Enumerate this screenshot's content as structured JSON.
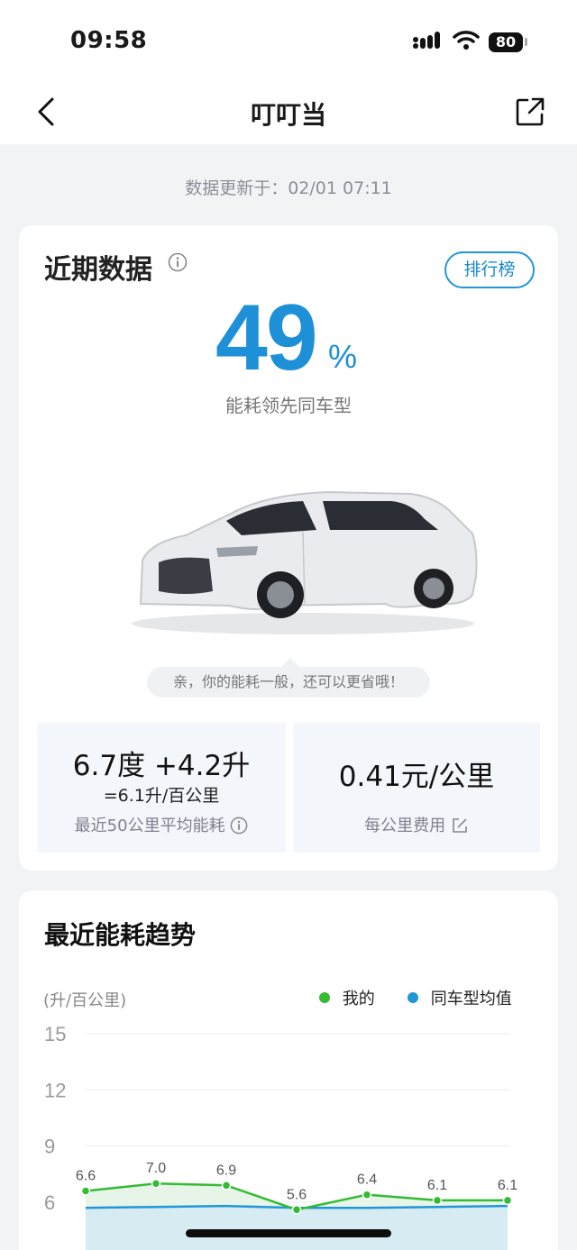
{
  "status_bar": {
    "time": "09:58",
    "battery": "80"
  },
  "nav": {
    "title": "叮叮当"
  },
  "update_text": "数据更新于：02/01 07:11",
  "recent": {
    "title": "近期数据",
    "rank_button": "排行榜",
    "percent": "49",
    "percent_sign": "%",
    "lead_text": "能耗领先同车型",
    "tip": "亲，你的能耗一般，还可以更省哦！",
    "stat_left": {
      "main": "6.7度 +4.2升",
      "sub": "=6.1升/百公里",
      "label": "最近50公里平均能耗"
    },
    "stat_right": {
      "main": "0.41元/公里",
      "label": "每公里费用"
    }
  },
  "trend": {
    "title": "最近能耗趋势",
    "unit": "(升/百公里)",
    "legend_mine": "我的",
    "legend_avg": "同车型均值"
  },
  "colors": {
    "accent": "#1d90d8",
    "mine": "#33bb33",
    "avg": "#2196d8"
  },
  "chart_data": {
    "type": "line",
    "ylabel": "(升/百公里)",
    "y_ticks": [
      "15",
      "12",
      "9",
      "6"
    ],
    "ylim": [
      6,
      15
    ],
    "series": [
      {
        "name": "我的",
        "values": [
          6.6,
          7.0,
          6.9,
          5.6,
          6.4,
          6.1,
          6.1
        ],
        "labels": [
          "6.6",
          "7.0",
          "6.9",
          "5.6",
          "6.4",
          "6.1",
          "6.1"
        ]
      },
      {
        "name": "同车型均值",
        "values": [
          5.7,
          5.75,
          5.8,
          5.7,
          5.7,
          5.75,
          5.8
        ]
      }
    ],
    "grid": true,
    "legend": "top-right"
  }
}
